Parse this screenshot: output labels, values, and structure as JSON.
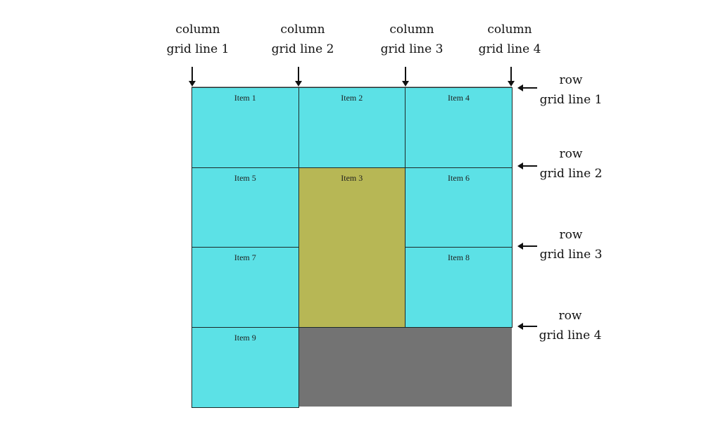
{
  "colors": {
    "item": "#5ce1e6",
    "highlight_item": "#b7b755",
    "empty_area": "#737373"
  },
  "column_labels": [
    {
      "line1": "column",
      "line2": "grid line 1"
    },
    {
      "line1": "column",
      "line2": "grid line 2"
    },
    {
      "line1": "column",
      "line2": "grid line 3"
    },
    {
      "line1": "column",
      "line2": "grid line 4"
    }
  ],
  "row_labels": [
    {
      "line1": "row",
      "line2": "grid line 1"
    },
    {
      "line1": "row",
      "line2": "grid line 2"
    },
    {
      "line1": "row",
      "line2": "grid line 3"
    },
    {
      "line1": "row",
      "line2": "grid line 4"
    }
  ],
  "items": [
    {
      "label": "Item 1",
      "col_start": 1,
      "col_end": 2,
      "row_start": 1,
      "row_end": 2,
      "highlight": false
    },
    {
      "label": "Item 2",
      "col_start": 2,
      "col_end": 3,
      "row_start": 1,
      "row_end": 2,
      "highlight": false
    },
    {
      "label": "Item 4",
      "col_start": 3,
      "col_end": 4,
      "row_start": 1,
      "row_end": 2,
      "highlight": false
    },
    {
      "label": "Item 5",
      "col_start": 1,
      "col_end": 2,
      "row_start": 2,
      "row_end": 3,
      "highlight": false
    },
    {
      "label": "Item 3",
      "col_start": 2,
      "col_end": 3,
      "row_start": 2,
      "row_end": 4,
      "highlight": true
    },
    {
      "label": "Item 6",
      "col_start": 3,
      "col_end": 4,
      "row_start": 2,
      "row_end": 3,
      "highlight": false
    },
    {
      "label": "Item 7",
      "col_start": 1,
      "col_end": 2,
      "row_start": 3,
      "row_end": 4,
      "highlight": false
    },
    {
      "label": "Item 8",
      "col_start": 3,
      "col_end": 4,
      "row_start": 3,
      "row_end": 4,
      "highlight": false
    },
    {
      "label": "Item 9",
      "col_start": 1,
      "col_end": 2,
      "row_start": 4,
      "row_end": 5,
      "highlight": false
    }
  ]
}
